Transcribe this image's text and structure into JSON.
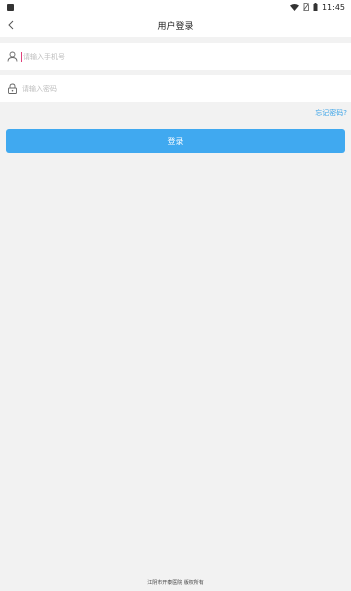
{
  "status_bar": {
    "time": "11:45",
    "icons": [
      "notification-icon",
      "wifi-icon",
      "no-sim-icon",
      "battery-icon"
    ]
  },
  "header": {
    "title": "用户登录",
    "back_icon": "chevron-left-icon"
  },
  "form": {
    "phone": {
      "icon": "user-icon",
      "placeholder": "请输入手机号",
      "value": ""
    },
    "password": {
      "icon": "lock-icon",
      "placeholder": "请输入密码",
      "value": ""
    },
    "forgot_label": "忘记密码?",
    "submit_label": "登录"
  },
  "footer": {
    "text": "江阴市开泰医院 版权所有"
  },
  "colors": {
    "accent": "#40a9f0",
    "link": "#3aa3e8",
    "caret": "#e0407b",
    "background": "#f2f2f2"
  }
}
